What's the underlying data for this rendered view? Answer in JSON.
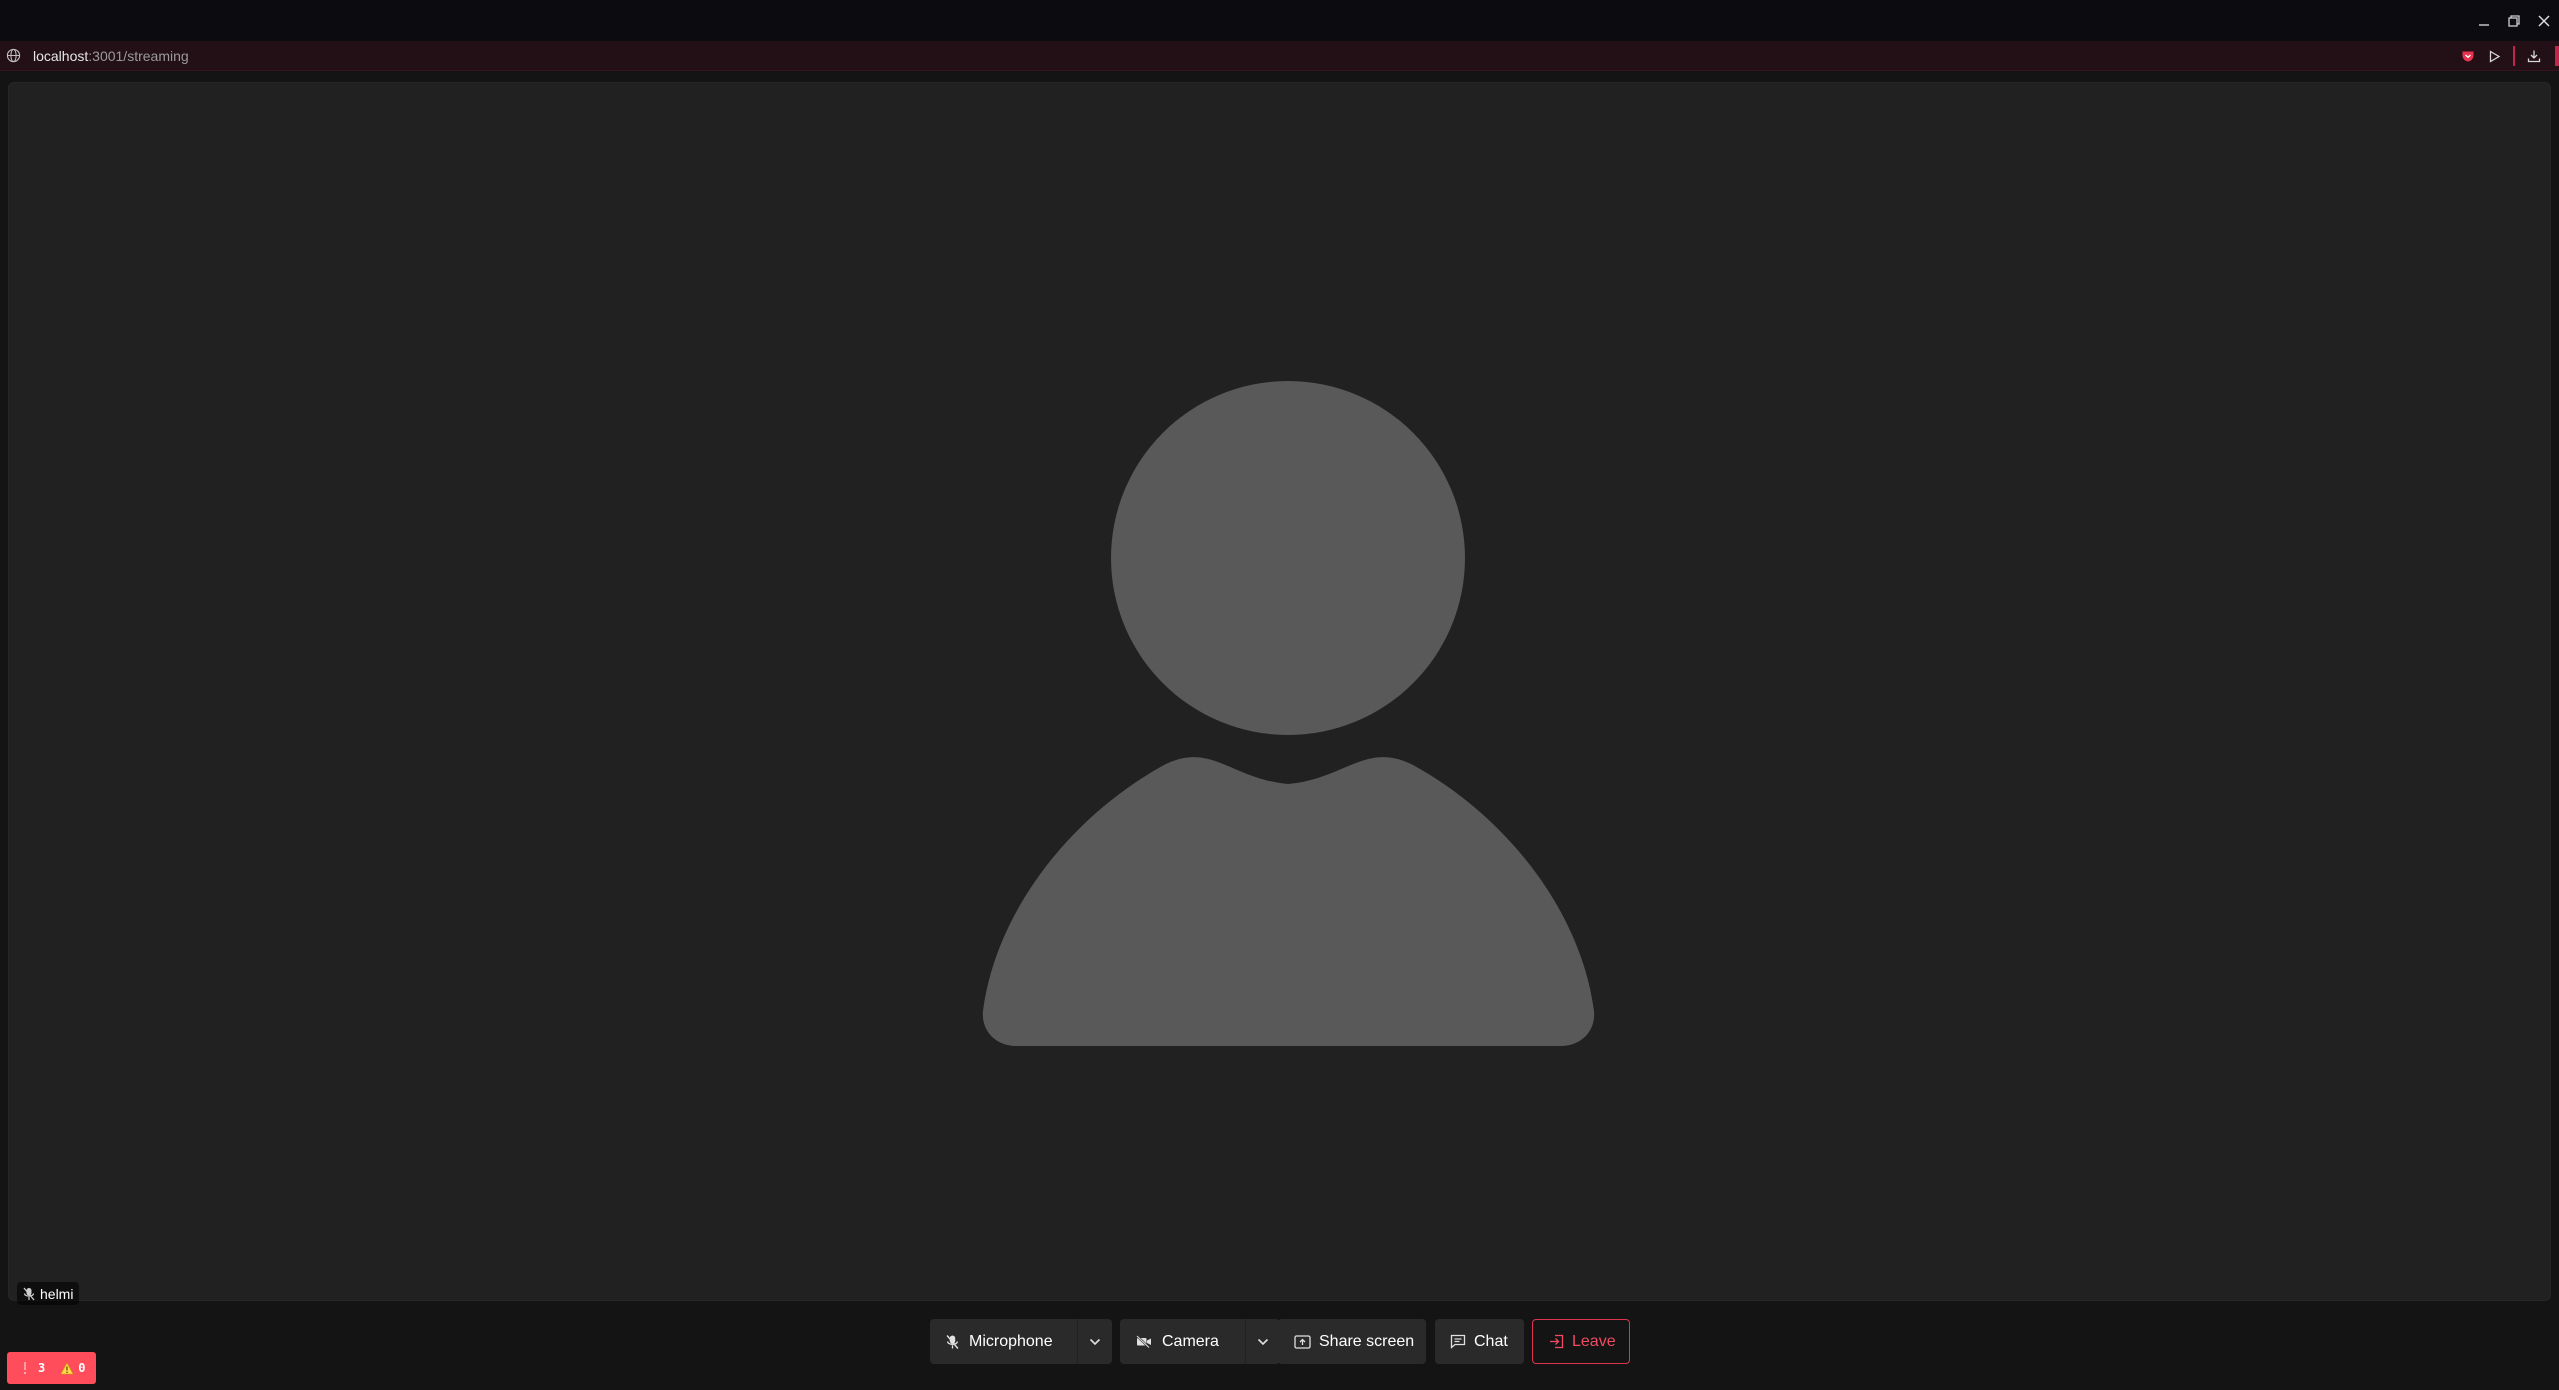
{
  "window": {
    "controls": [
      "minimize",
      "restore",
      "close"
    ]
  },
  "addressbar": {
    "host": "localhost",
    "path": ":3001/streaming",
    "accent_color": "#c4254a"
  },
  "participant": {
    "name": "helmi",
    "mic_muted": true
  },
  "controls": {
    "microphone_label": "Microphone",
    "camera_label": "Camera",
    "share_label": "Share screen",
    "chat_label": "Chat",
    "leave_label": "Leave",
    "leave_color": "#e0354f"
  },
  "issues": {
    "errors": "3",
    "warnings": "0",
    "badge_color": "#ff4d5c"
  }
}
